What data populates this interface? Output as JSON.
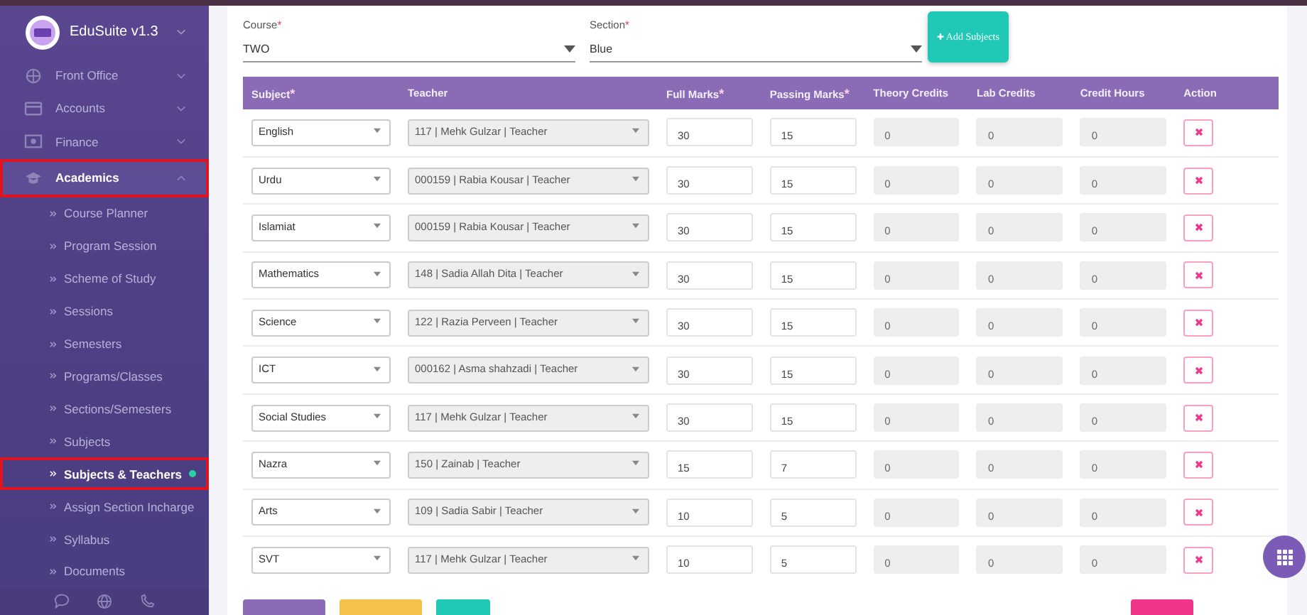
{
  "sidebar": {
    "brand": "EduSuite v1.3",
    "items": [
      {
        "label": "Front Office",
        "expanded": false,
        "marked": false
      },
      {
        "label": "Accounts",
        "expanded": false,
        "marked": false
      },
      {
        "label": "Finance",
        "expanded": false,
        "marked": false
      },
      {
        "label": "Academics",
        "expanded": true,
        "marked": true,
        "children": [
          {
            "label": "Course Planner",
            "selected": false,
            "marked": false
          },
          {
            "label": "Program Session",
            "selected": false,
            "marked": false
          },
          {
            "label": "Scheme of Study",
            "selected": false,
            "marked": false
          },
          {
            "label": "Sessions",
            "selected": false,
            "marked": false
          },
          {
            "label": "Semesters",
            "selected": false,
            "marked": false
          },
          {
            "label": "Programs/Classes",
            "selected": false,
            "marked": false
          },
          {
            "label": "Sections/Semesters",
            "selected": false,
            "marked": false
          },
          {
            "label": "Subjects",
            "selected": false,
            "marked": false
          },
          {
            "label": "Subjects & Teachers",
            "selected": true,
            "marked": true
          },
          {
            "label": "Assign Section Incharge",
            "selected": false,
            "marked": false
          },
          {
            "label": "Syllabus",
            "selected": false,
            "marked": false
          },
          {
            "label": "Documents",
            "selected": false,
            "marked": false
          }
        ]
      }
    ]
  },
  "filters": [
    {
      "label": "Course",
      "required_mark": "*",
      "value": "TWO"
    },
    {
      "label": "Section",
      "required_mark": "*",
      "value": "Blue"
    }
  ],
  "add_button": {
    "icon": "✚",
    "label": "Add Subjects"
  },
  "table": {
    "columns": [
      {
        "label": "Subject",
        "required_mark": "*"
      },
      {
        "label": "Teacher"
      },
      {
        "label": "Full Marks",
        "required_mark": "*"
      },
      {
        "label": "Passing Marks",
        "required_mark": "*"
      },
      {
        "label": "Theory Credits"
      },
      {
        "label": "Lab Credits"
      },
      {
        "label": "Credit Hours"
      },
      {
        "label": "Action"
      }
    ],
    "rows": [
      {
        "subject": "English",
        "teacher": "117 | Mehk Gulzar | Teacher",
        "full_marks": "30",
        "passing_marks": "15",
        "theory_credits": "0",
        "lab_credits": "0",
        "credit_hours": "0"
      },
      {
        "subject": "Urdu",
        "teacher": "000159 | Rabia Kousar | Teacher",
        "full_marks": "30",
        "passing_marks": "15",
        "theory_credits": "0",
        "lab_credits": "0",
        "credit_hours": "0"
      },
      {
        "subject": "Islamiat",
        "teacher": "000159 | Rabia Kousar | Teacher",
        "full_marks": "30",
        "passing_marks": "15",
        "theory_credits": "0",
        "lab_credits": "0",
        "credit_hours": "0"
      },
      {
        "subject": "Mathematics",
        "teacher": "148 | Sadia Allah Dita | Teacher",
        "full_marks": "30",
        "passing_marks": "15",
        "theory_credits": "0",
        "lab_credits": "0",
        "credit_hours": "0"
      },
      {
        "subject": "Science",
        "teacher": "122 | Razia Perveen | Teacher",
        "full_marks": "30",
        "passing_marks": "15",
        "theory_credits": "0",
        "lab_credits": "0",
        "credit_hours": "0"
      },
      {
        "subject": "ICT",
        "teacher": "000162 | Asma shahzadi | Teacher",
        "full_marks": "30",
        "passing_marks": "15",
        "theory_credits": "0",
        "lab_credits": "0",
        "credit_hours": "0"
      },
      {
        "subject": "Social Studies",
        "teacher": "117 | Mehk Gulzar | Teacher",
        "full_marks": "30",
        "passing_marks": "15",
        "theory_credits": "0",
        "lab_credits": "0",
        "credit_hours": "0"
      },
      {
        "subject": "Nazra",
        "teacher": "150 | Zainab | Teacher",
        "full_marks": "15",
        "passing_marks": "7",
        "theory_credits": "0",
        "lab_credits": "0",
        "credit_hours": "0"
      },
      {
        "subject": "Arts",
        "teacher": "109 | Sadia Sabir | Teacher",
        "full_marks": "10",
        "passing_marks": "5",
        "theory_credits": "0",
        "lab_credits": "0",
        "credit_hours": "0"
      },
      {
        "subject": "SVT",
        "teacher": "117 | Mehk Gulzar | Teacher",
        "full_marks": "10",
        "passing_marks": "5",
        "theory_credits": "0",
        "lab_credits": "0",
        "credit_hours": "0"
      }
    ]
  },
  "bottom_buttons": [
    {
      "color": "#8a6bb5"
    },
    {
      "color": "#f7c04a"
    },
    {
      "color": "#1fc9b5"
    },
    {
      "color": "#f0358a"
    }
  ]
}
